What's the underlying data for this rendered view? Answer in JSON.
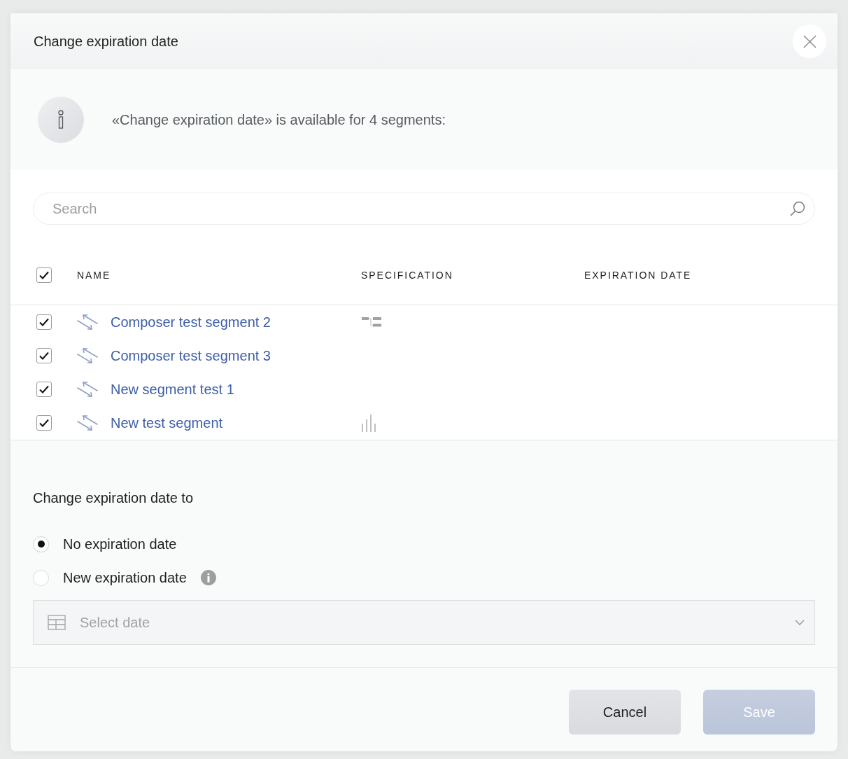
{
  "dialog": {
    "title": "Change expiration date"
  },
  "notice": {
    "text": "«Change expiration date» is available for 4 segments:"
  },
  "search": {
    "placeholder": "Search"
  },
  "table": {
    "select_all": {
      "checked": true
    },
    "columns": [
      "NAME",
      "SPECIFICATION",
      "EXPIRATION DATE"
    ],
    "rows": [
      {
        "checked": true,
        "name": "Composer test segment 2",
        "kind": "hierarchy"
      },
      {
        "checked": true,
        "name": "Composer test segment 3",
        "kind": "plain"
      },
      {
        "checked": true,
        "name": "New segment test 1",
        "kind": "plain"
      },
      {
        "checked": true,
        "name": "New test segment",
        "kind": "bars"
      }
    ]
  },
  "form": {
    "title": "Change expiration date to",
    "options": [
      {
        "label": "No expiration date",
        "selected": true,
        "info_icon": false
      },
      {
        "label": "New expiration date",
        "selected": false,
        "info_icon": true
      }
    ],
    "date_field": {
      "placeholder": "Select date",
      "disabled": true
    }
  },
  "buttons": [
    {
      "label": "Cancel",
      "kind": "secondary"
    },
    {
      "label": "Save",
      "kind": "primary",
      "disabled": true
    }
  ]
}
